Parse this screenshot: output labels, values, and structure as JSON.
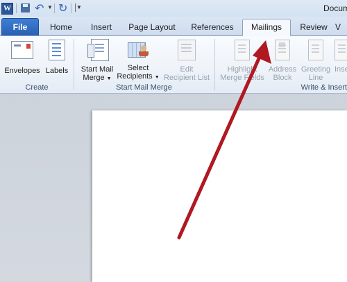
{
  "window": {
    "title": "Docum"
  },
  "quick_access": {
    "app_icon_letter": "W"
  },
  "tabs": [
    {
      "label": "File"
    },
    {
      "label": "Home"
    },
    {
      "label": "Insert"
    },
    {
      "label": "Page Layout"
    },
    {
      "label": "References"
    },
    {
      "label": "Mailings"
    },
    {
      "label": "Review"
    },
    {
      "label": "V"
    }
  ],
  "active_tab": "Mailings",
  "ribbon": {
    "create": {
      "label": "Create",
      "envelopes": "Envelopes",
      "labels": "Labels"
    },
    "start_mail_merge": {
      "label": "Start Mail Merge",
      "start_line1": "Start Mail",
      "start_line2": "Merge",
      "select_line1": "Select",
      "select_line2": "Recipients",
      "edit_line1": "Edit",
      "edit_line2": "Recipient List"
    },
    "write_insert": {
      "label": "Write & Insert",
      "highlight_line1": "Highlight",
      "highlight_line2": "Merge Fields",
      "address_line1": "Address",
      "address_line2": "Block",
      "greeting_line1": "Greeting",
      "greeting_line2": "Line",
      "insert_line1": "Inse"
    }
  },
  "colors": {
    "file_tab": "#2860b4",
    "annotation_arrow": "#b01822"
  }
}
